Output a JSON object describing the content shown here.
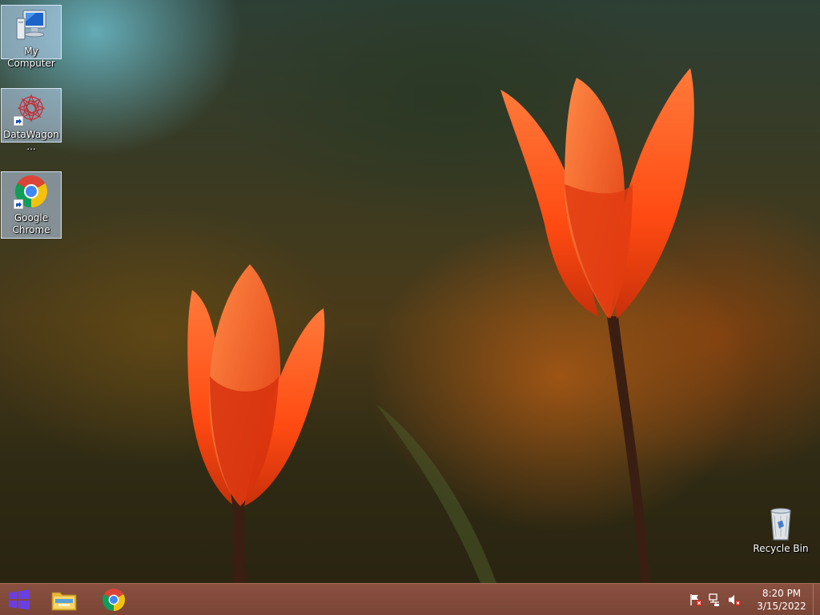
{
  "desktop": {
    "icons": [
      {
        "label": "My Computer",
        "icon": "computer-icon"
      },
      {
        "label": "DataWagon...",
        "icon": "datawagon-icon"
      },
      {
        "label": "Google Chrome",
        "icon": "chrome-icon"
      },
      {
        "label": "Recycle Bin",
        "icon": "recycle-bin-icon"
      }
    ]
  },
  "taskbar": {
    "start_icon": "windows-logo-icon",
    "pinned": [
      {
        "name": "File Explorer",
        "icon": "folder-icon"
      },
      {
        "name": "Google Chrome",
        "icon": "chrome-icon"
      }
    ],
    "tray_icons": [
      "action-center-flag-icon",
      "network-icon",
      "volume-muted-icon"
    ],
    "clock": {
      "time": "8:20 PM",
      "date": "3/15/2022"
    }
  },
  "colors": {
    "taskbar": "#7a4536",
    "start_logo": "#6a3fe0",
    "tulip": "#ff5a1a"
  }
}
